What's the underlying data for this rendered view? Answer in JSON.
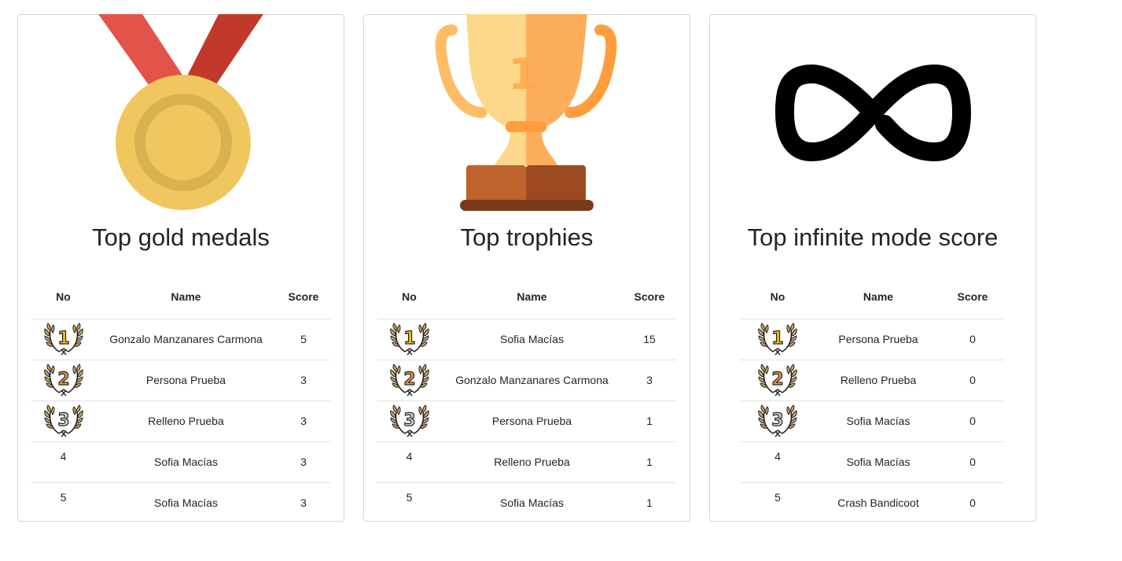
{
  "headers": {
    "no": "No",
    "name": "Name",
    "score": "Score"
  },
  "cards": [
    {
      "title": "Top gold medals",
      "icon": "gold-medal-icon",
      "rows": [
        {
          "no": "1",
          "name": "Gonzalo Manzanares Carmona",
          "score": "5"
        },
        {
          "no": "2",
          "name": "Persona Prueba",
          "score": "3"
        },
        {
          "no": "3",
          "name": "Relleno Prueba",
          "score": "3"
        },
        {
          "no": "4",
          "name": "Sofia Macías",
          "score": "3"
        },
        {
          "no": "5",
          "name": "Sofia Macías",
          "score": "3"
        }
      ]
    },
    {
      "title": "Top trophies",
      "icon": "trophy-icon",
      "rows": [
        {
          "no": "1",
          "name": "Sofia Macías",
          "score": "15"
        },
        {
          "no": "2",
          "name": "Gonzalo Manzanares Carmona",
          "score": "3"
        },
        {
          "no": "3",
          "name": "Persona Prueba",
          "score": "1"
        },
        {
          "no": "4",
          "name": "Relleno Prueba",
          "score": "1"
        },
        {
          "no": "5",
          "name": "Sofia Macías",
          "score": "1"
        }
      ]
    },
    {
      "title": "Top infinite mode score",
      "icon": "infinity-icon",
      "rows": [
        {
          "no": "1",
          "name": "Persona Prueba",
          "score": "0"
        },
        {
          "no": "2",
          "name": "Relleno Prueba",
          "score": "0"
        },
        {
          "no": "3",
          "name": "Sofia Macías",
          "score": "0"
        },
        {
          "no": "4",
          "name": "Sofia Macías",
          "score": "0"
        },
        {
          "no": "5",
          "name": "Crash Bandicoot",
          "score": "0"
        }
      ]
    }
  ],
  "colors": {
    "rank1": "#f5c518",
    "rank2": "#f0913a",
    "rank3": "#d0d0d0",
    "medal_gold": "#efc75e",
    "ribbon": "#d9443a",
    "trophy": "#fdbd66"
  }
}
